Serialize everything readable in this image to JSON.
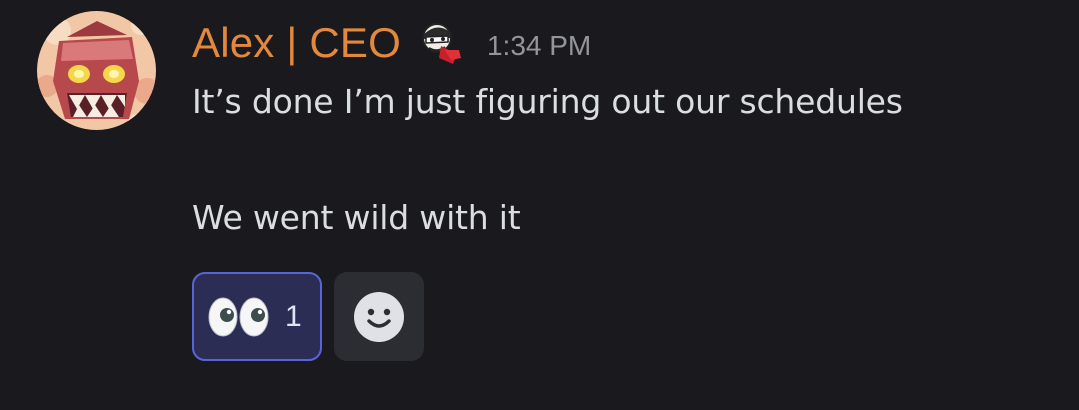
{
  "message": {
    "author": {
      "name": "Alex | CEO",
      "name_color": "#e3883c",
      "avatar_icon": "masked-character-avatar",
      "badge_icon": "cartoon-face-role-icon"
    },
    "timestamp": "1:34 PM",
    "lines": [
      "It’s done I’m just figuring out our schedules",
      "We went wild with it"
    ],
    "reactions": [
      {
        "emoji": "eyes-emoji",
        "count": "1",
        "reacted_by_me": true
      }
    ],
    "add_reaction_icon": "smiley-face-icon"
  },
  "colors": {
    "background": "#1a1a1e",
    "text": "#dbdee1",
    "timestamp": "#94959c",
    "reaction_active_bg": "#2b2d54",
    "reaction_active_border": "#5865d8",
    "add_reaction_bg": "#2b2d33"
  }
}
